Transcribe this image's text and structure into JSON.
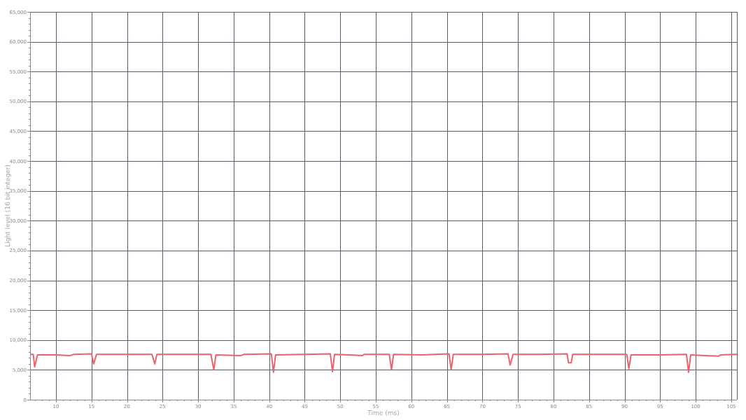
{
  "chart": {
    "chart_data": {
      "type": "line",
      "grid": true,
      "xlabel": "Time (ms)",
      "ylabel": "Light level (16 bit integer)",
      "xlim": [
        6.36,
        105.8
      ],
      "ylim": [
        0,
        65000
      ],
      "xticks": [
        10,
        15,
        20,
        25,
        30,
        35,
        40,
        45,
        50,
        55,
        60,
        65,
        70,
        75,
        80,
        85,
        90,
        95,
        100,
        105
      ],
      "yticks": [
        {
          "value": 0,
          "label": "0"
        },
        {
          "value": 5000,
          "label": "5,000"
        },
        {
          "value": 10000,
          "label": "10,000"
        },
        {
          "value": 15000,
          "label": "15,000"
        },
        {
          "value": 20000,
          "label": "20,000"
        },
        {
          "value": 25000,
          "label": "25,000"
        },
        {
          "value": 30000,
          "label": "30,000"
        },
        {
          "value": 35000,
          "label": "35,000"
        },
        {
          "value": 40000,
          "label": "40,000"
        },
        {
          "value": 45000,
          "label": "45,000"
        },
        {
          "value": 50000,
          "label": "50,000"
        },
        {
          "value": 55000,
          "label": "55,000"
        },
        {
          "value": 60000,
          "label": "60,000"
        },
        {
          "value": 65000,
          "label": "65,000"
        }
      ],
      "x": [
        6.4,
        6.8,
        7.0,
        7.4,
        10,
        12,
        12.5,
        15.0,
        15.3,
        15.7,
        20,
        23.5,
        23.9,
        24.2,
        28,
        31.8,
        32.2,
        32.5,
        36,
        36.5,
        40.3,
        40.6,
        40.9,
        45,
        48.6,
        48.9,
        49.2,
        53.1,
        53.4,
        56.9,
        57.2,
        57.5,
        61.5,
        65.3,
        65.6,
        65.9,
        70,
        73.6,
        73.9,
        74.3,
        78,
        81.9,
        82.1,
        82.5,
        82.7,
        86,
        90.3,
        90.6,
        90.9,
        95,
        98.7,
        99.0,
        99.3,
        103.2,
        103.5,
        105.8
      ],
      "series": [
        {
          "color": "#e8636d",
          "values": [
            7600,
            7600,
            5500,
            7500,
            7500,
            7400,
            7600,
            7700,
            6000,
            7600,
            7600,
            7600,
            6000,
            7600,
            7600,
            7600,
            5000,
            7500,
            7400,
            7600,
            7700,
            4600,
            7500,
            7600,
            7700,
            4700,
            7600,
            7400,
            7600,
            7600,
            5000,
            7600,
            7500,
            7700,
            5000,
            7600,
            7600,
            7700,
            5800,
            7600,
            7600,
            7700,
            6200,
            6200,
            7600,
            7600,
            7600,
            5200,
            7500,
            7500,
            7600,
            4600,
            7500,
            7300,
            7500,
            7600
          ]
        }
      ]
    }
  }
}
